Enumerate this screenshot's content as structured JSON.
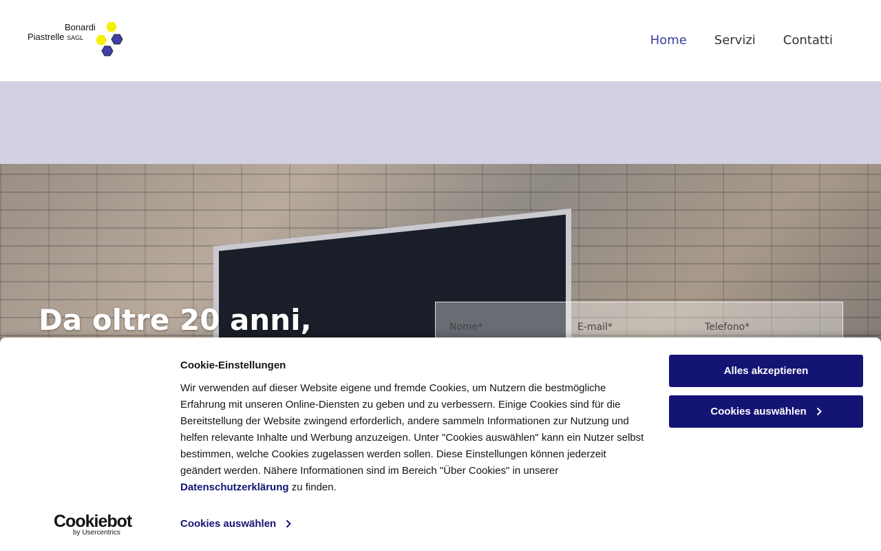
{
  "logo": {
    "line1": "Bonardi",
    "line2": "Piastrelle",
    "suffix": "SAGL"
  },
  "nav": {
    "items": [
      {
        "label": "Home",
        "active": true
      },
      {
        "label": "Servizi"
      },
      {
        "label": "Contatti"
      }
    ]
  },
  "hero": {
    "title": "Da oltre 20 anni,"
  },
  "form": {
    "name_placeholder": "Nome*",
    "email_placeholder": "E-mail*",
    "phone_placeholder": "Telefono*"
  },
  "cookie": {
    "title": "Cookie-Einstellungen",
    "text_before_link": "Wir verwenden auf dieser Website eigene und fremde Cookies, um Nutzern die bestmögliche Erfahrung mit unseren Online-Diensten zu geben und zu verbessern. Einige Cookies sind für die Bereitstellung der Website zwingend erforderlich, andere sammeln Informationen zur Nutzung und helfen relevante Inhalte und Werbung anzuzeigen. Unter \"Cookies auswählen\" kann ein Nutzer selbst bestimmen, welche Cookies zugelassen werden sollen. Diese Einstellungen können jederzeit geändert werden. Nähere Informationen sind im Bereich \"Über Cookies\" in unserer ",
    "link_text": "Datenschutzerklärung",
    "text_after_link": " zu finden.",
    "accept_label": "Alles akzeptieren",
    "select_label": "Cookies auswählen",
    "select_link_label": "Cookies auswählen",
    "brand": "Cookiebot",
    "brand_sub": "by Usercentrics"
  },
  "colors": {
    "accent": "#141475",
    "nav_active": "#3c3c9c",
    "band": "#d2d0e3"
  }
}
